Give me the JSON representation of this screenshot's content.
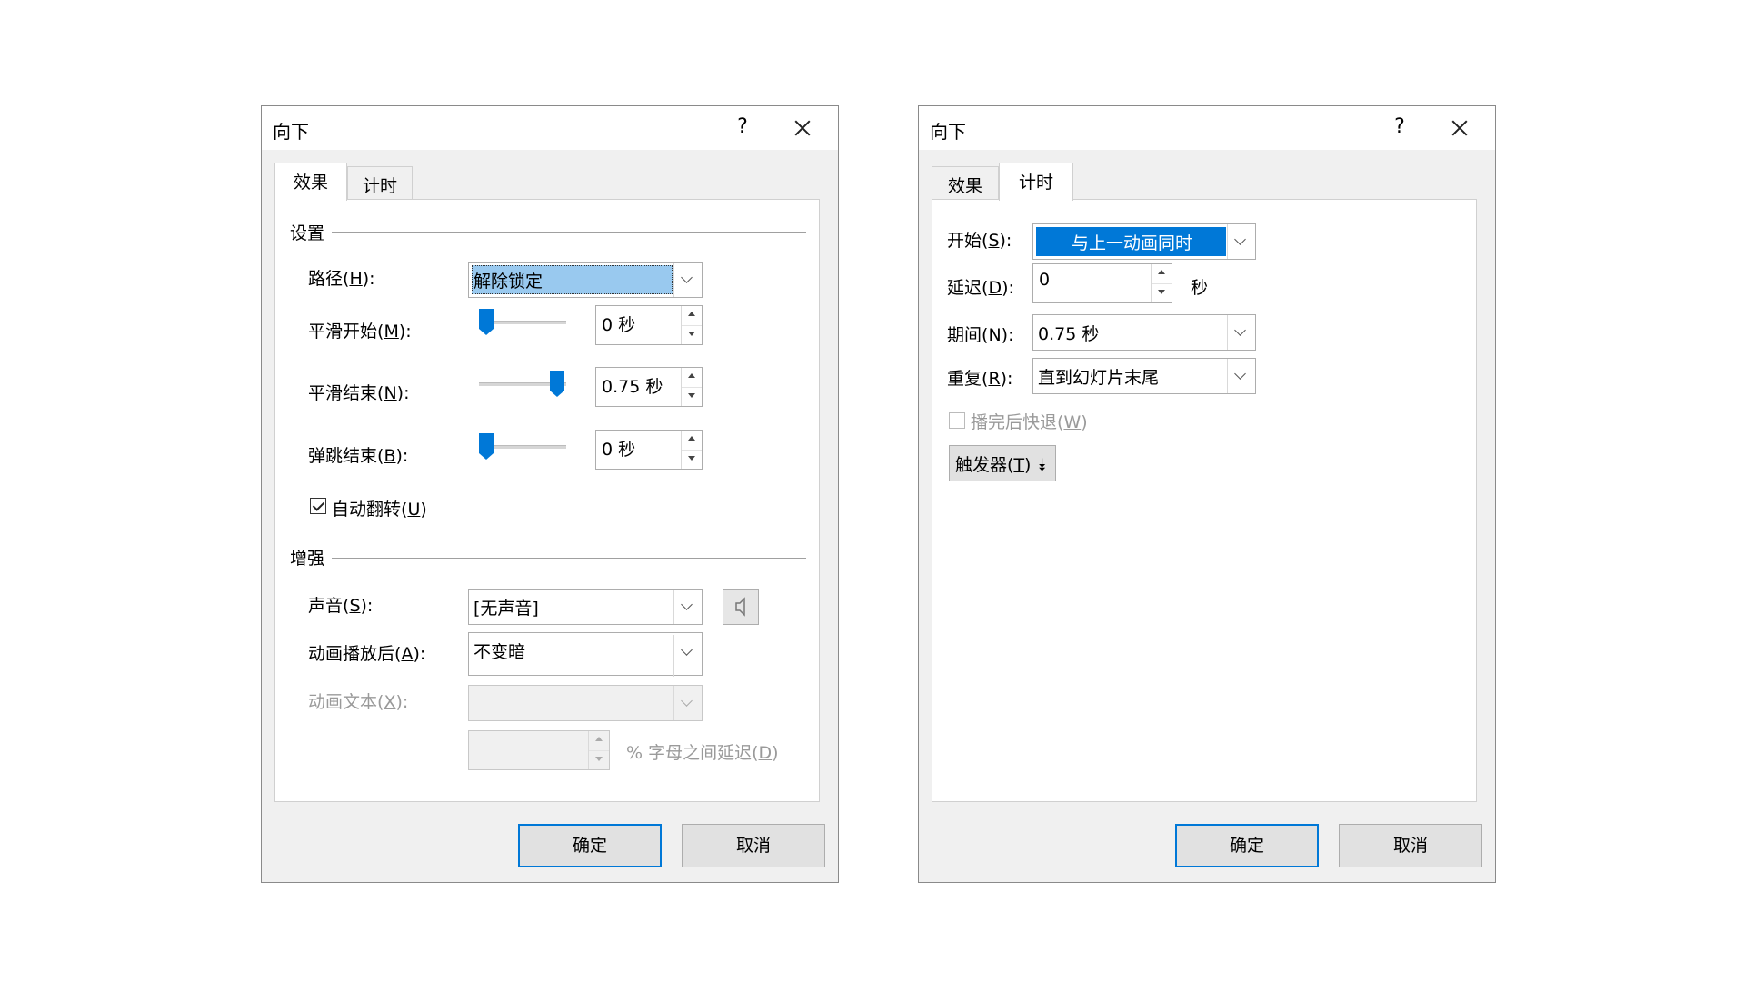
{
  "left_dialog": {
    "title": "向下",
    "help": "?",
    "tabs": [
      {
        "label": "效果",
        "active": true
      },
      {
        "label": "计时",
        "active": false
      }
    ],
    "settings_group": "设置",
    "path": {
      "label": "路径",
      "key": "H",
      "value": "解除锁定"
    },
    "smooth_start": {
      "label": "平滑开始",
      "key": "M",
      "value": "0 秒",
      "slider_fraction": 0.0
    },
    "smooth_end": {
      "label": "平滑结束",
      "key": "N",
      "value": "0.75 秒",
      "slider_fraction": 1.0
    },
    "bounce_end": {
      "label": "弹跳结束",
      "key": "B",
      "value": "0 秒",
      "slider_fraction": 0.0
    },
    "auto_reverse": {
      "label": "自动翻转",
      "key": "U",
      "checked": true
    },
    "enhance_group": "增强",
    "sound": {
      "label": "声音",
      "key": "S",
      "value": "[无声音]"
    },
    "after_animation": {
      "label": "动画播放后",
      "key": "A",
      "value": "不变暗"
    },
    "animate_text": {
      "label": "动画文本",
      "key": "X",
      "value": ""
    },
    "letter_delay": {
      "value": "",
      "suffix": "% 字母之间延迟",
      "key": "D"
    },
    "ok": "确定",
    "cancel": "取消"
  },
  "right_dialog": {
    "title": "向下",
    "help": "?",
    "tabs": [
      {
        "label": "效果",
        "active": false
      },
      {
        "label": "计时",
        "active": true
      }
    ],
    "start": {
      "label": "开始",
      "key": "S",
      "value": "与上一动画同时"
    },
    "delay": {
      "label": "延迟",
      "key": "D",
      "value": "0",
      "unit": "秒"
    },
    "duration": {
      "label": "期间",
      "key": "N",
      "value": "0.75 秒"
    },
    "repeat": {
      "label": "重复",
      "key": "R",
      "value": "直到幻灯片末尾"
    },
    "rewind": {
      "label": "播完后快退",
      "key": "W",
      "checked": false
    },
    "trigger": {
      "label": "触发器",
      "key": "T",
      "arrow": "⯯"
    },
    "ok": "确定",
    "cancel": "取消"
  },
  "colors": {
    "accent": "#0078d7",
    "selection_light": "#99c9ef",
    "dialog_bg": "#f0f0f0",
    "disabled_text": "#9a9a9a"
  }
}
